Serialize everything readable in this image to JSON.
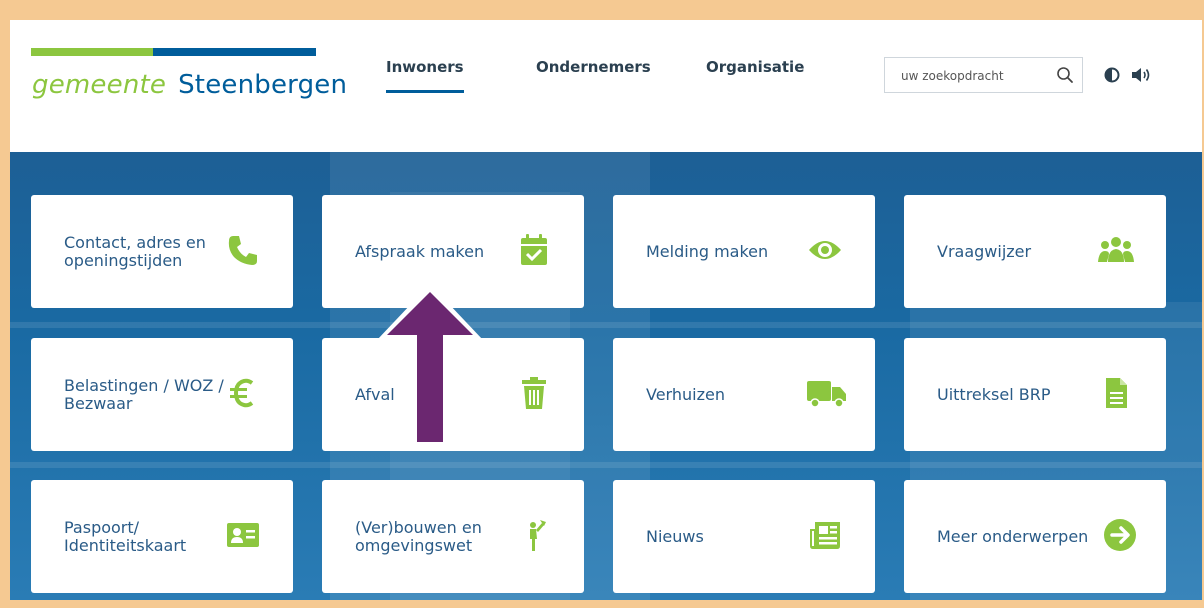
{
  "header": {
    "logo": {
      "prefix": "gemeente",
      "name": "Steenbergen"
    },
    "nav": [
      {
        "label": "Inwoners",
        "active": true
      },
      {
        "label": "Ondernemers",
        "active": false
      },
      {
        "label": "Organisatie",
        "active": false
      }
    ],
    "search": {
      "placeholder": "uw zoekopdracht",
      "icon": "search-icon"
    },
    "tools": {
      "contrast_icon": "contrast-icon",
      "speaker_icon": "speaker-icon"
    }
  },
  "tiles": [
    {
      "label": "Contact, adres en openingstijden",
      "icon": "phone-icon"
    },
    {
      "label": "Afspraak maken",
      "icon": "calendar-check-icon"
    },
    {
      "label": "Melding maken",
      "icon": "eye-icon"
    },
    {
      "label": "Vraagwijzer",
      "icon": "users-icon"
    },
    {
      "label": "Belastingen / WOZ / Bezwaar",
      "icon": "euro-icon"
    },
    {
      "label": "Afval",
      "icon": "trash-icon"
    },
    {
      "label": "Verhuizen",
      "icon": "truck-icon"
    },
    {
      "label": "Uittreksel BRP",
      "icon": "document-icon"
    },
    {
      "label": "Paspoort/ Identiteitskaart",
      "icon": "id-card-icon"
    },
    {
      "label": "(Ver)bouwen en omgevingswet",
      "icon": "construction-worker-icon"
    },
    {
      "label": "Nieuws",
      "icon": "newspaper-icon"
    },
    {
      "label": "Meer onderwerpen",
      "icon": "arrow-right-circle-icon"
    }
  ],
  "annotation": {
    "icon": "arrow-up-icon",
    "color": "#6b2770"
  },
  "colors": {
    "brand_blue": "#005d9b",
    "brand_green": "#8cc63f",
    "frame": "#f5c992"
  }
}
